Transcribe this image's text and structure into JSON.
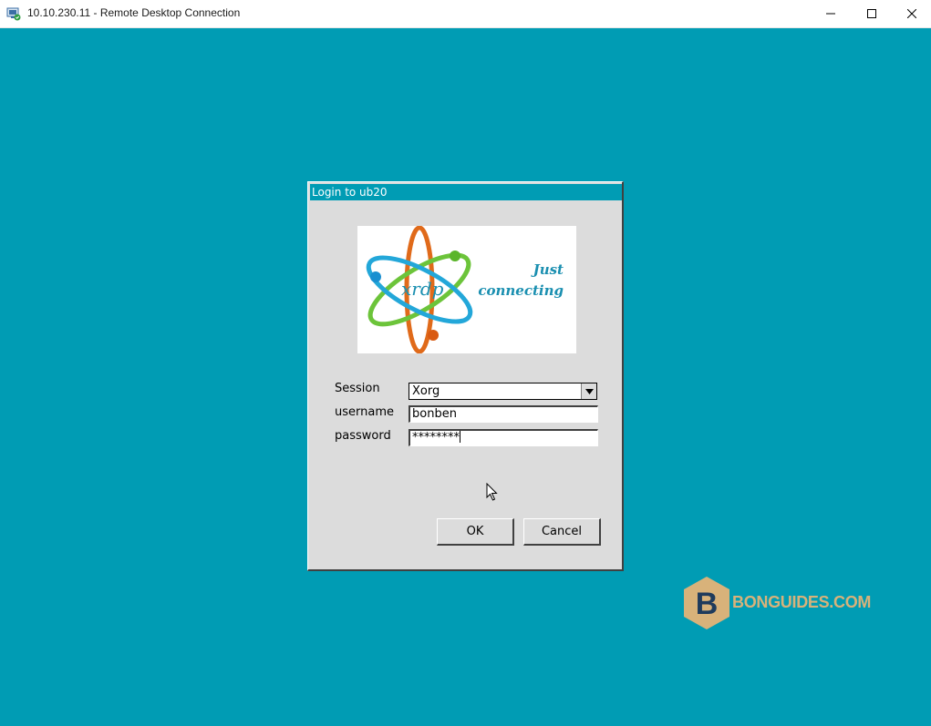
{
  "window": {
    "title": "10.10.230.11 - Remote Desktop Connection",
    "icons": {
      "app": "remote-desktop-icon",
      "minimize": "minimize-icon",
      "maximize": "maximize-icon",
      "close": "close-icon"
    }
  },
  "dialog": {
    "title": "Login to ub20",
    "logo": {
      "brand": "xrdp",
      "tagline_line1": "Just",
      "tagline_line2": "connecting"
    },
    "fields": {
      "session_label": "Session",
      "session_value": "Xorg",
      "username_label": "username",
      "username_value": "bonben",
      "password_label": "password",
      "password_value": "********"
    },
    "buttons": {
      "ok": "OK",
      "cancel": "Cancel"
    }
  },
  "watermark": {
    "letter": "B",
    "text": "BONGUIDES.COM"
  },
  "colors": {
    "desktop": "#009cb4",
    "dialog_bg": "#dcdcdc",
    "watermark": "#d8b27a",
    "watermark_letter": "#1f3b5c"
  }
}
